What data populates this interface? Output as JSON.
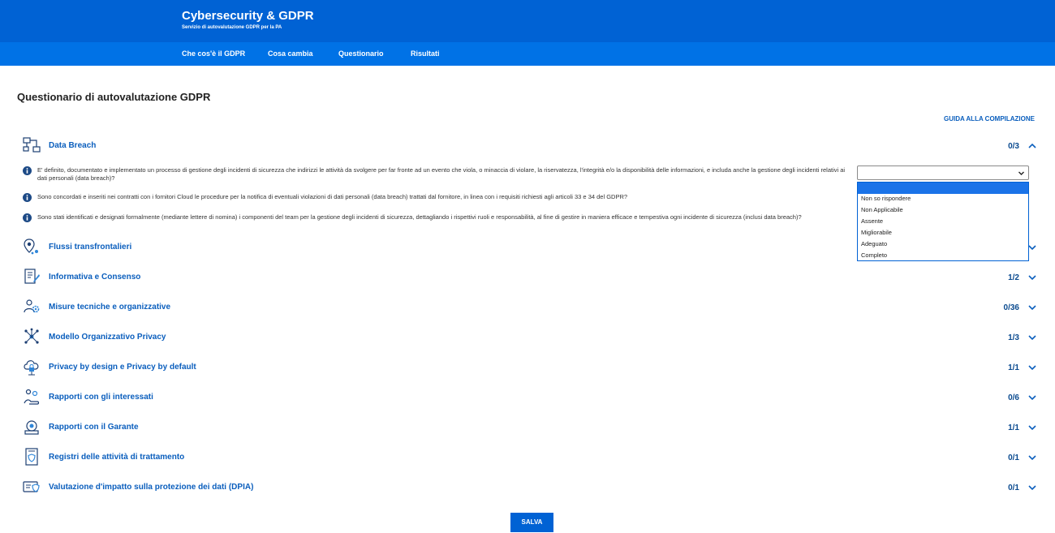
{
  "header": {
    "title": "Cybersecurity & GDPR",
    "subtitle": "Servizio di autovalutazione GDPR per la PA",
    "brand_color": "#0062d4"
  },
  "nav": {
    "items": [
      "Che cos'è il GDPR",
      "Cosa cambia",
      "Questionario",
      "Risultati"
    ]
  },
  "main": {
    "title": "Questionario di autovalutazione GDPR",
    "guide_link": "GUIDA ALLA COMPILAZIONE",
    "sections": [
      {
        "label": "Data Breach",
        "count": "0/3",
        "icon": "network-icon",
        "expanded": true
      },
      {
        "label": "Flussi transfrontalieri",
        "count": "",
        "icon": "location-pin-icon",
        "expanded": false
      },
      {
        "label": "Informativa e Consenso",
        "count": "1/2",
        "icon": "document-pen-icon",
        "expanded": false
      },
      {
        "label": "Misure tecniche e organizzative",
        "count": "0/36",
        "icon": "people-gear-icon",
        "expanded": false
      },
      {
        "label": "Modello Organizzativo Privacy",
        "count": "1/3",
        "icon": "hub-icon",
        "expanded": false
      },
      {
        "label": "Privacy by design e Privacy by default",
        "count": "1/1",
        "icon": "cloud-lock-icon",
        "expanded": false
      },
      {
        "label": "Rapporti con gli interessati",
        "count": "0/6",
        "icon": "hand-people-icon",
        "expanded": false
      },
      {
        "label": "Rapporti con il Garante",
        "count": "1/1",
        "icon": "shield-badge-icon",
        "expanded": false
      },
      {
        "label": "Registri delle attività di trattamento",
        "count": "0/1",
        "icon": "register-shield-icon",
        "expanded": false
      },
      {
        "label": "Valutazione d'impatto sulla protezione dei dati (DPIA)",
        "count": "0/1",
        "icon": "card-shield-icon",
        "expanded": false
      }
    ],
    "questions": [
      "E' definito, documentato e implementato un processo di gestione degli incidenti di sicurezza che indirizzi le attività da svolgere per far fronte ad un evento che viola, o minaccia di violare, la riservatezza, l'integrità e/o la disponibilità delle informazioni, e includa anche la gestione degli incidenti relativi ai dati personali (data breach)?",
      "Sono concordati e inseriti nei contratti con i fornitori Cloud le procedure per la notifica di eventuali violazioni di dati personali (data breach) trattati dal fornitore, in linea con i requisiti richiesti agli articoli 33 e 34 del GDPR?",
      "Sono stati identificati e designati formalmente (mediante lettere di nomina) i componenti del team per la gestione degli incidenti di sicurezza, dettagliando i rispettivi ruoli e responsabilità, al fine di gestire in maniera efficace e tempestiva ogni incidente di sicurezza (inclusi data breach)?"
    ],
    "select": {
      "value": "",
      "options": [
        "",
        "Non so rispondere",
        "Non Applicabile",
        "Assente",
        "Migliorabile",
        "Adeguato",
        "Completo"
      ]
    },
    "save_label": "SALVA"
  }
}
